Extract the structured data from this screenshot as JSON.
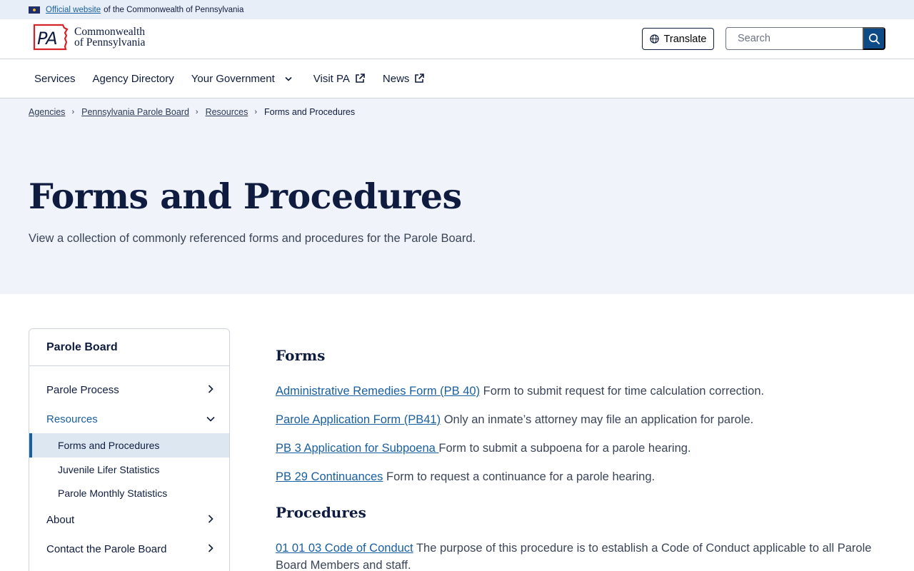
{
  "banner": {
    "link_text": "Official website",
    "text": "of the Commonwealth of Pennsylvania"
  },
  "header": {
    "logo_line1": "Commonwealth",
    "logo_line2": "of Pennsylvania",
    "logo_mark": "PA",
    "translate_label": "Translate",
    "search_placeholder": "Search"
  },
  "nav": {
    "items": [
      {
        "label": "Services"
      },
      {
        "label": "Agency Directory"
      },
      {
        "label": "Your Government"
      },
      {
        "label": "Visit PA"
      },
      {
        "label": "News"
      }
    ]
  },
  "breadcrumb": {
    "items": [
      "Agencies",
      "Pennsylvania Parole Board",
      "Resources"
    ],
    "current": "Forms and Procedures"
  },
  "hero": {
    "title": "Forms and Procedures",
    "description": "View a collection of commonly referenced forms and procedures for the Parole Board."
  },
  "sidebar": {
    "title": "Parole Board",
    "items": [
      {
        "label": "Parole Process"
      },
      {
        "label": "Resources"
      },
      {
        "label": "About"
      },
      {
        "label": "Contact the Parole Board"
      }
    ],
    "sub_items": [
      {
        "label": "Forms and Procedures"
      },
      {
        "label": "Juvenile Lifer Statistics"
      },
      {
        "label": "Parole Monthly Statistics"
      }
    ]
  },
  "main": {
    "forms_heading": "Forms",
    "forms": [
      {
        "link": "Administrative Remedies Form (PB 40)",
        "desc": " Form to submit request for time calculation correction."
      },
      {
        "link": "Parole Application Form (PB41)",
        "desc": " Only an inmate’s attorney may file an application for parole."
      },
      {
        "link": "PB 3 Application for Subpoena ",
        "desc": " Form to submit a subpoena for a parole hearing."
      },
      {
        "link": "PB 29 Continuances",
        "desc": " Form to request a continuance for a parole hearing."
      }
    ],
    "procedures_heading": "Procedures",
    "procedures": [
      {
        "link": "01 01 03 Code of Conduct",
        "desc": " The purpose of this procedure is to establish a Code of Conduct applicable to all Parole Board Members and staff."
      }
    ]
  }
}
